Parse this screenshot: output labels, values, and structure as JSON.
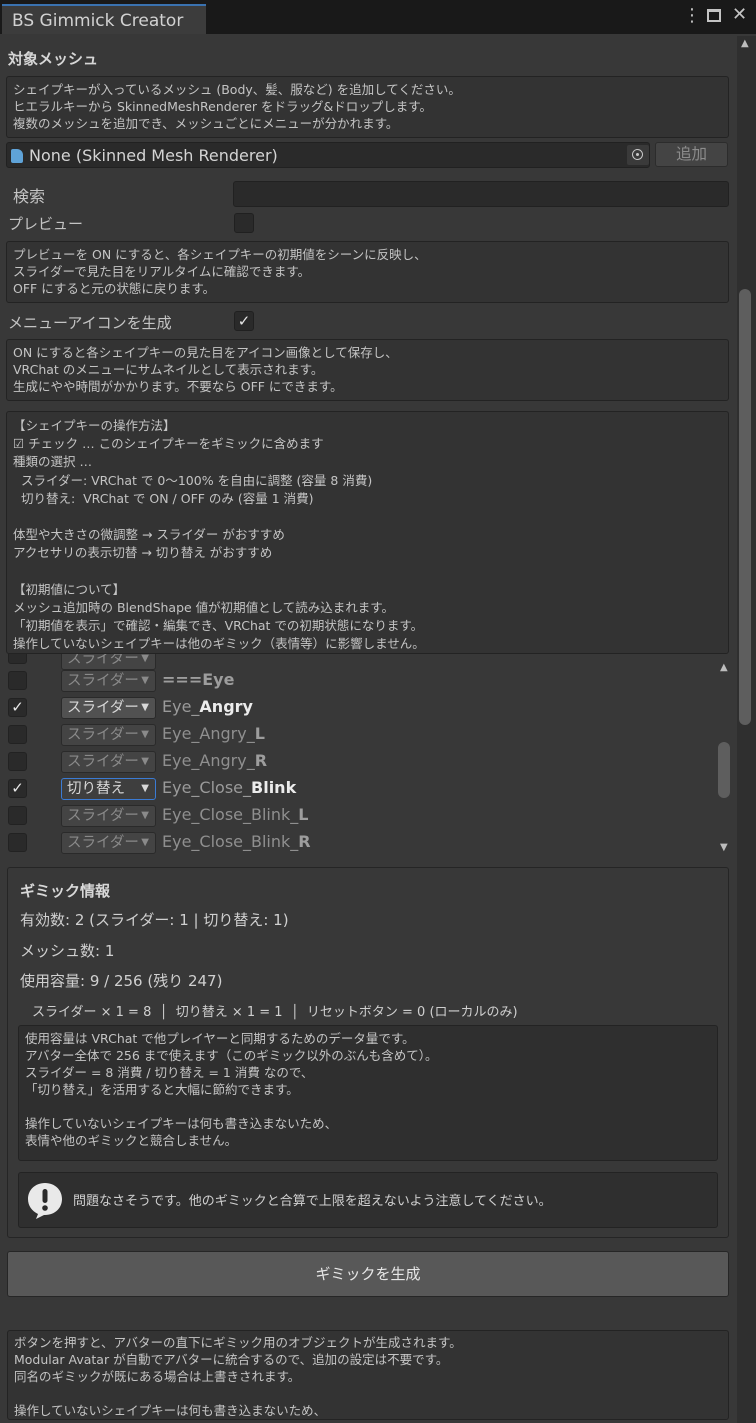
{
  "window": {
    "title": "BS Gimmick Creator",
    "menu_icon": "kebab-menu-icon",
    "maximize_icon": "maximize-icon",
    "close_icon": "close-icon"
  },
  "target_mesh": {
    "heading": "対象メッシュ",
    "help": "シェイプキーが入っているメッシュ (Body、髪、服など) を追加してください。\nヒエラルキーから SkinnedMeshRenderer をドラッグ&ドロップします。\n複数のメッシュを追加でき、メッシュごとにメニューが分かれます。",
    "object_field_value": "None (Skinned Mesh Renderer)",
    "add_button": "追加"
  },
  "search": {
    "label": "検索",
    "value": ""
  },
  "preview": {
    "label": "プレビュー",
    "checked": false,
    "help": "プレビューを ON にすると、各シェイプキーの初期値をシーンに反映し、\nスライダーで見た目をリアルタイムに確認できます。\nOFF にすると元の状態に戻ります。"
  },
  "menu_icon_option": {
    "label": "メニューアイコンを生成",
    "checked": true,
    "help": "ON にすると各シェイプキーの見た目をアイコン画像として保存し、\nVRChat のメニューにサムネイルとして表示されます。\n生成にやや時間がかかります。不要なら OFF にできます。"
  },
  "instructions": "【シェイプキーの操作方法】\n☑ チェック … このシェイプキーをギミックに含めます\n種類の選択 …\n  スライダー: VRChat で 0〜100% を自由に調整 (容量 8 消費)\n  切り替え:  VRChat で ON / OFF のみ (容量 1 消費)\n\n体型や大きさの微調整 → スライダー がおすすめ\nアクセサリの表示切替 → 切り替え がおすすめ\n\n【初期値について】\nメッシュ追加時の BlendShape 値が初期値として読み込まれます。\n「初期値を表示」で確認・編集でき、VRChat での初期状態になります。\n操作していないシェイプキーは他のギミック（表情等）に影響しません。",
  "shapekeys": [
    {
      "checked": false,
      "type": "スライダー",
      "prefix": "",
      "name": "===Eye",
      "enabled": false
    },
    {
      "checked": true,
      "type": "スライダー",
      "prefix": "Eye_",
      "name": "Angry",
      "enabled": true
    },
    {
      "checked": false,
      "type": "スライダー",
      "prefix": "Eye_Angry_",
      "name": "L",
      "enabled": false
    },
    {
      "checked": false,
      "type": "スライダー",
      "prefix": "Eye_Angry_",
      "name": "R",
      "enabled": false
    },
    {
      "checked": true,
      "type": "切り替え",
      "prefix": "Eye_Close_",
      "name": "Blink",
      "enabled": true,
      "focused": true
    },
    {
      "checked": false,
      "type": "スライダー",
      "prefix": "Eye_Close_Blink_",
      "name": "L",
      "enabled": false
    },
    {
      "checked": false,
      "type": "スライダー",
      "prefix": "Eye_Close_Blink_",
      "name": "R",
      "enabled": false
    }
  ],
  "gimmick_info": {
    "heading": "ギミック情報",
    "active_count": "有効数: 2  (スライダー: 1 | 切り替え: 1)",
    "mesh_count": "メッシュ数: 1",
    "capacity": "使用容量: 9 / 256  (残り 247)",
    "breakdown": "スライダー × 1 = 8  │  切り替え × 1 = 1  │  リセットボタン = 0 (ローカルのみ)",
    "help": "使用容量は VRChat で他プレイヤーと同期するためのデータ量です。\nアバター全体で 256 まで使えます（このギミック以外のぶんも含めて）。\nスライダー = 8 消費 / 切り替え = 1 消費 なので、\n「切り替え」を活用すると大幅に節約できます。\n\n操作していないシェイプキーは何も書き込まないため、\n表情や他のギミックと競合しません。",
    "notice_icon": "exclamation-bubble-icon",
    "notice": "問題なさそうです。他のギミックと合算で上限を超えないよう注意してください。"
  },
  "generate_button": "ギミックを生成",
  "footer_help": "ボタンを押すと、アバターの直下にギミック用のオブジェクトが生成されます。\nModular Avatar が自動でアバターに統合するので、追加の設定は不要です。\n同名のギミックが既にある場合は上書きされます。\n\n操作していないシェイプキーは何も書き込まないため、\n表情や他のギミックと競合しません。"
}
